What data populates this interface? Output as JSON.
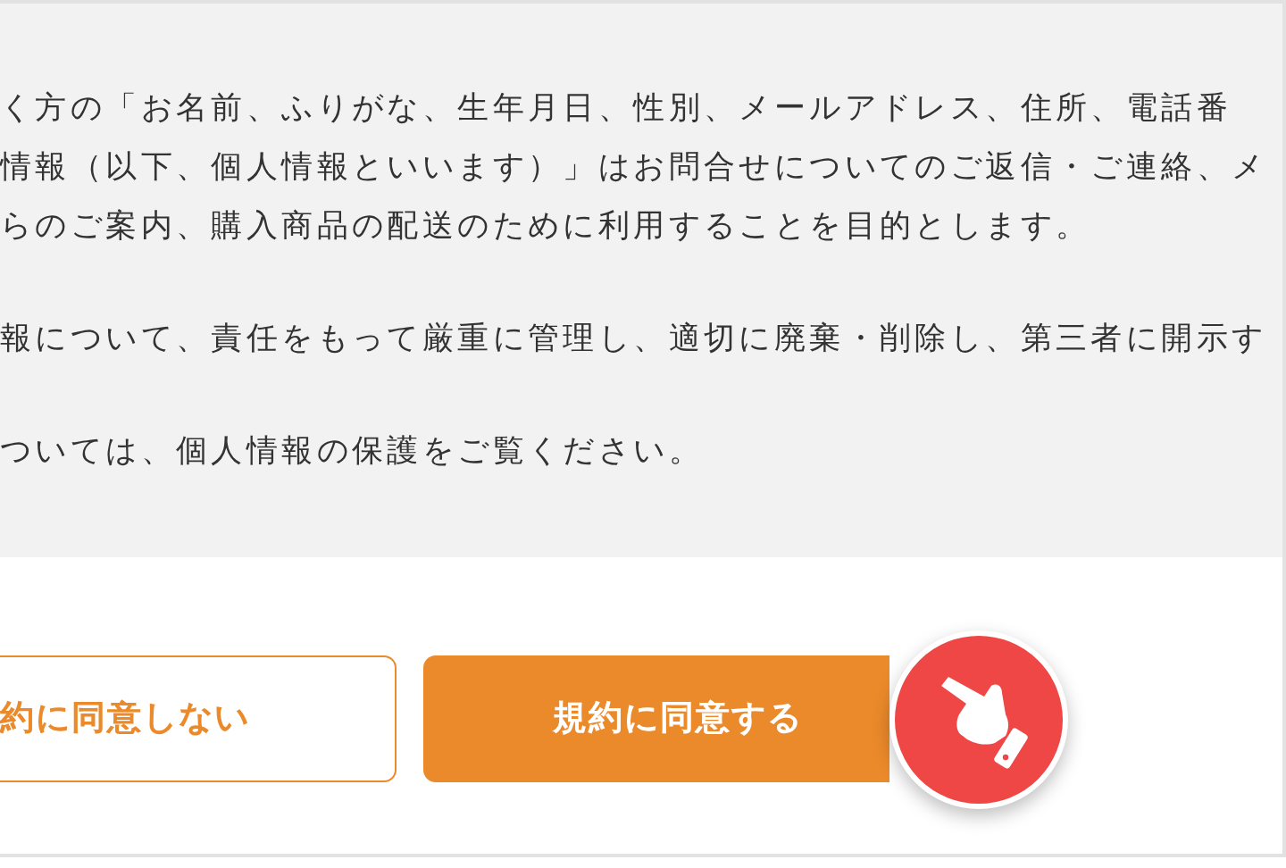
{
  "notice": {
    "paragraphs": [
      [
        "く方の「お名前、ふりがな、生年月日、性別、メールアドレス、住所、電話番",
        "情報（以下、個人情報といいます）」はお問合せについてのご返信・ご連絡、メ",
        "らのご案内、購入商品の配送のために利用することを目的とします。"
      ],
      [
        "報について、責任をもって厳重に管理し、適切に廃棄・削除し、第三者に開示す"
      ],
      [
        "ついては、個人情報の保護をご覧ください。"
      ]
    ]
  },
  "buttons": [
    {
      "kind": "outline",
      "label": "約に同意しない"
    },
    {
      "kind": "filled",
      "label": "規約に同意する"
    }
  ]
}
